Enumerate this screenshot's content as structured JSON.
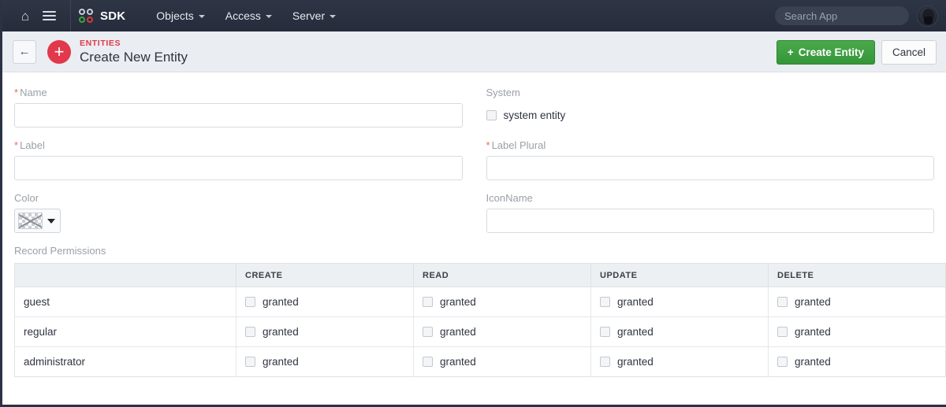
{
  "navbar": {
    "home_icon": "home-icon",
    "menu_icon": "hamburger-menu-icon",
    "brand_icon": "sdk-circles-icon",
    "brand": "SDK",
    "items": [
      {
        "label": "Objects",
        "has_caret": true
      },
      {
        "label": "Access",
        "has_caret": true
      },
      {
        "label": "Server",
        "has_caret": true
      }
    ],
    "search_placeholder": "Search App",
    "search_value": "",
    "avatar_icon": "user-avatar"
  },
  "subbar": {
    "back_icon": "back-arrow-icon",
    "add_icon": "plus-icon",
    "eyebrow": "ENTITIES",
    "title": "Create New Entity",
    "create_label": "Create Entity",
    "create_plus": "+",
    "cancel_label": "Cancel",
    "create_color": "#3d9a40",
    "accent_color": "#e2384b"
  },
  "form": {
    "name": {
      "label": "Name",
      "required": true,
      "value": "",
      "placeholder": ""
    },
    "system": {
      "label": "System",
      "checkbox_label": "system entity",
      "checked": false
    },
    "label_field": {
      "label": "Label",
      "required": true,
      "value": "",
      "placeholder": ""
    },
    "label_plural": {
      "label": "Label Plural",
      "required": true,
      "value": "",
      "placeholder": ""
    },
    "color": {
      "label": "Color",
      "value": "",
      "swatch": "transparent-checkerboard",
      "caret": "▼"
    },
    "icon_name": {
      "label": "IconName",
      "value": "",
      "placeholder": ""
    }
  },
  "permissions": {
    "section_label": "Record Permissions",
    "columns": [
      "",
      "CREATE",
      "READ",
      "UPDATE",
      "DELETE"
    ],
    "granted_label": "granted",
    "rows": [
      {
        "role": "guest",
        "create": false,
        "read": false,
        "update": false,
        "delete": false
      },
      {
        "role": "regular",
        "create": false,
        "read": false,
        "update": false,
        "delete": false
      },
      {
        "role": "administrator",
        "create": false,
        "read": false,
        "update": false,
        "delete": false
      }
    ]
  }
}
